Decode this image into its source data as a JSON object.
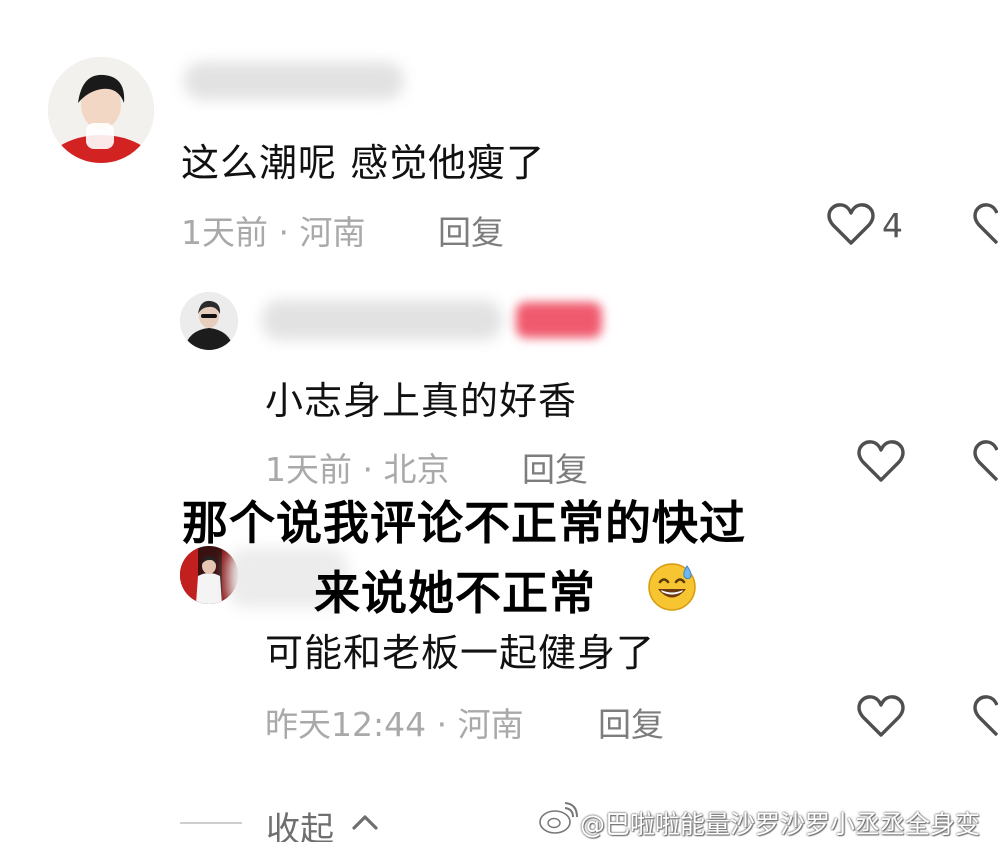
{
  "comments": [
    {
      "text": "这么潮呢 感觉他瘦了",
      "meta": "1天前 · 河南",
      "reply_label": "回复",
      "like_count": "4"
    },
    {
      "text": "小志身上真的好香",
      "meta": "1天前 · 北京",
      "reply_label": "回复"
    },
    {
      "text": "可能和老板一起健身了",
      "meta": "昨天12:44 · 河南",
      "reply_label": "回复"
    }
  ],
  "overlay": {
    "line1": "那个说我评论不正常的快过",
    "line2": "来说她不正常"
  },
  "collapse_label": "收起",
  "watermark": "@巴啦啦能量沙罗沙罗小丞丞全身变",
  "colors": {
    "meta_gray": "#a9a9a9",
    "reply_gray": "#7d7d7d",
    "badge_pink": "#f05a6e"
  },
  "icons": [
    "heart-outline-icon",
    "chevron-up-icon",
    "weibo-logo-icon",
    "sweat-smile-emoji"
  ]
}
